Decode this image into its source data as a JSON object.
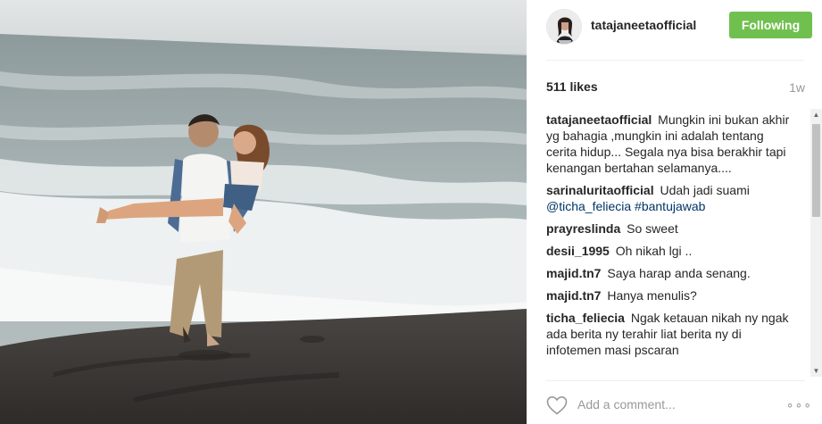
{
  "post": {
    "username": "tatajaneetaofficial",
    "follow_label": "Following",
    "likes": "511 likes",
    "time_ago": "1w"
  },
  "comments": [
    {
      "user": "tatajaneetaofficial",
      "text": "Mungkin ini bukan akhir yg bahagia ,mungkin ini adalah tentang cerita hidup... Segala nya bisa berakhir tapi kenangan bertahan selamanya...."
    },
    {
      "user": "sarinaluritaofficial",
      "text": "Udah jadi suami",
      "mention": "@ticha_feliecia #bantujawab"
    },
    {
      "user": "prayreslinda",
      "text": "So sweet"
    },
    {
      "user": "desii_1995",
      "text": "Oh nikah lgi .."
    },
    {
      "user": "majid.tn7",
      "text": "Saya harap anda senang."
    },
    {
      "user": "majid.tn7",
      "text": "Hanya menulis?"
    },
    {
      "user": "ticha_feliecia",
      "text": "Ngak ketauan nikah ny ngak ada berita ny terahir liat berita ny di infotemen masi pscaran"
    }
  ],
  "add_comment": {
    "placeholder": "Add a comment...",
    "more_label": "∘∘∘"
  },
  "icons": {
    "heart": "heart-icon",
    "more": "more-options-icon",
    "scroll_up": "scroll-up-arrow-icon",
    "scroll_down": "scroll-down-arrow-icon"
  },
  "colors": {
    "follow_button": "#70c050",
    "mention": "#003569",
    "muted": "#999999"
  }
}
